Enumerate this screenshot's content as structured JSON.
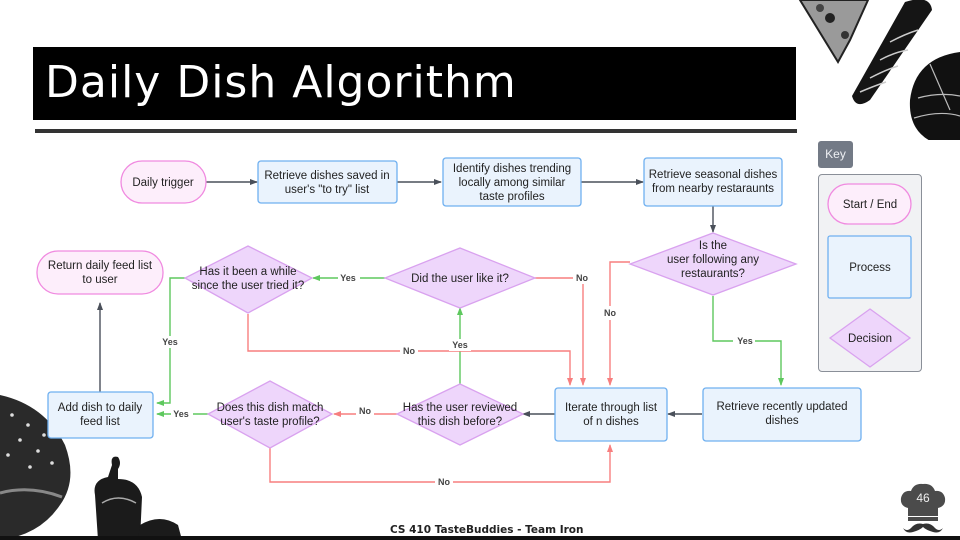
{
  "slide": {
    "title": "Daily Dish Algorithm",
    "footer": "CS 410 TasteBuddies - Team Iron",
    "page_number": "46"
  },
  "colors": {
    "start_end_fill": "#fdeefb",
    "start_end_stroke": "#f08ae0",
    "process_fill": "#eaf3fd",
    "process_stroke": "#6fb0f0",
    "decision_fill": "#eed6fb",
    "decision_stroke": "#d9a2ef",
    "yes_edge": "#5ec85e",
    "no_edge": "#f77f7f",
    "neutral_edge": "#4a505a"
  },
  "key": {
    "title": "Key",
    "items": [
      {
        "type": "start_end",
        "label": "Start / End"
      },
      {
        "type": "process",
        "label": "Process"
      },
      {
        "type": "decision",
        "label": "Decision"
      }
    ]
  },
  "nodes": {
    "daily_trigger": {
      "type": "start_end",
      "lines": [
        "Daily trigger"
      ]
    },
    "retrieve_saved": {
      "type": "process",
      "lines": [
        "Retrieve dishes saved in",
        "user's \"to try\" list"
      ]
    },
    "identify_trending": {
      "type": "process",
      "lines": [
        "Identify dishes trending",
        "locally among similar",
        "taste profiles"
      ]
    },
    "retrieve_seasonal": {
      "type": "process",
      "lines": [
        "Retrieve seasonal dishes",
        "from nearby restaraunts"
      ]
    },
    "following_restaurants": {
      "type": "decision",
      "lines": [
        "Is the",
        "user following any",
        "restaurants?"
      ]
    },
    "retrieve_updated": {
      "type": "process",
      "lines": [
        "Retrieve recently updated",
        "dishes"
      ]
    },
    "iterate_dishes": {
      "type": "process",
      "lines": [
        "Iterate through list",
        "of n dishes"
      ]
    },
    "reviewed_before": {
      "type": "decision",
      "lines": [
        "Has the user reviewed",
        "this dish before?"
      ]
    },
    "did_like": {
      "type": "decision",
      "lines": [
        "Did the user like it?"
      ]
    },
    "been_a_while": {
      "type": "decision",
      "lines": [
        "Has it been a while",
        "since the user tried it?"
      ]
    },
    "match_profile": {
      "type": "decision",
      "lines": [
        "Does this dish match",
        "user's taste profile?"
      ]
    },
    "add_to_feed": {
      "type": "process",
      "lines": [
        "Add dish to daily",
        "feed list"
      ]
    },
    "return_feed": {
      "type": "start_end",
      "lines": [
        "Return daily feed list",
        "to user"
      ]
    }
  },
  "edges": [
    {
      "from": "daily_trigger",
      "to": "retrieve_saved",
      "label": ""
    },
    {
      "from": "retrieve_saved",
      "to": "identify_trending",
      "label": ""
    },
    {
      "from": "identify_trending",
      "to": "retrieve_seasonal",
      "label": ""
    },
    {
      "from": "retrieve_seasonal",
      "to": "following_restaurants",
      "label": ""
    },
    {
      "from": "following_restaurants",
      "to": "retrieve_updated",
      "label": "Yes"
    },
    {
      "from": "following_restaurants",
      "to": "iterate_dishes",
      "label": "No"
    },
    {
      "from": "retrieve_updated",
      "to": "iterate_dishes",
      "label": ""
    },
    {
      "from": "iterate_dishes",
      "to": "reviewed_before",
      "label": ""
    },
    {
      "from": "reviewed_before",
      "to": "did_like",
      "label": "Yes"
    },
    {
      "from": "reviewed_before",
      "to": "match_profile",
      "label": "No"
    },
    {
      "from": "did_like",
      "to": "been_a_while",
      "label": "Yes"
    },
    {
      "from": "did_like",
      "to": "iterate_dishes",
      "label": "No"
    },
    {
      "from": "been_a_while",
      "to": "add_to_feed",
      "label": "Yes"
    },
    {
      "from": "been_a_while",
      "to": "iterate_dishes",
      "label": "No"
    },
    {
      "from": "match_profile",
      "to": "add_to_feed",
      "label": "Yes"
    },
    {
      "from": "match_profile",
      "to": "iterate_dishes",
      "label": "No"
    },
    {
      "from": "add_to_feed",
      "to": "return_feed",
      "label": ""
    }
  ]
}
